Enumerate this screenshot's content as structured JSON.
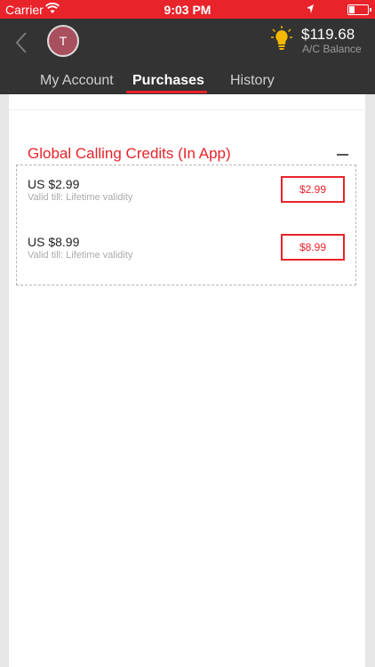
{
  "status_bar": {
    "carrier": "Carrier",
    "time": "9:03 PM",
    "battery_percent": "",
    "colors": {
      "background": "#e8232a"
    },
    "icons": [
      "wifi-icon",
      "location-arrow-icon",
      "battery-icon"
    ]
  },
  "header": {
    "avatar_initial": "T",
    "balance_amount": "$119.68",
    "balance_label": "A/C Balance",
    "icons": [
      "back-chevron-icon",
      "lightbulb-icon"
    ]
  },
  "tabs": [
    {
      "label": "My Account",
      "active": false
    },
    {
      "label": "Purchases",
      "active": true
    },
    {
      "label": "History",
      "active": false
    }
  ],
  "section": {
    "title": "Global Calling Credits (In App)",
    "products": [
      {
        "title": "US $2.99",
        "validity": "Valid till: Lifetime validity",
        "button_label": "$2.99"
      },
      {
        "title": "US $8.99",
        "validity": "Valid till: Lifetime validity",
        "button_label": "$8.99"
      }
    ]
  },
  "colors": {
    "accent": "#e8232a",
    "header_bg": "#333333"
  }
}
